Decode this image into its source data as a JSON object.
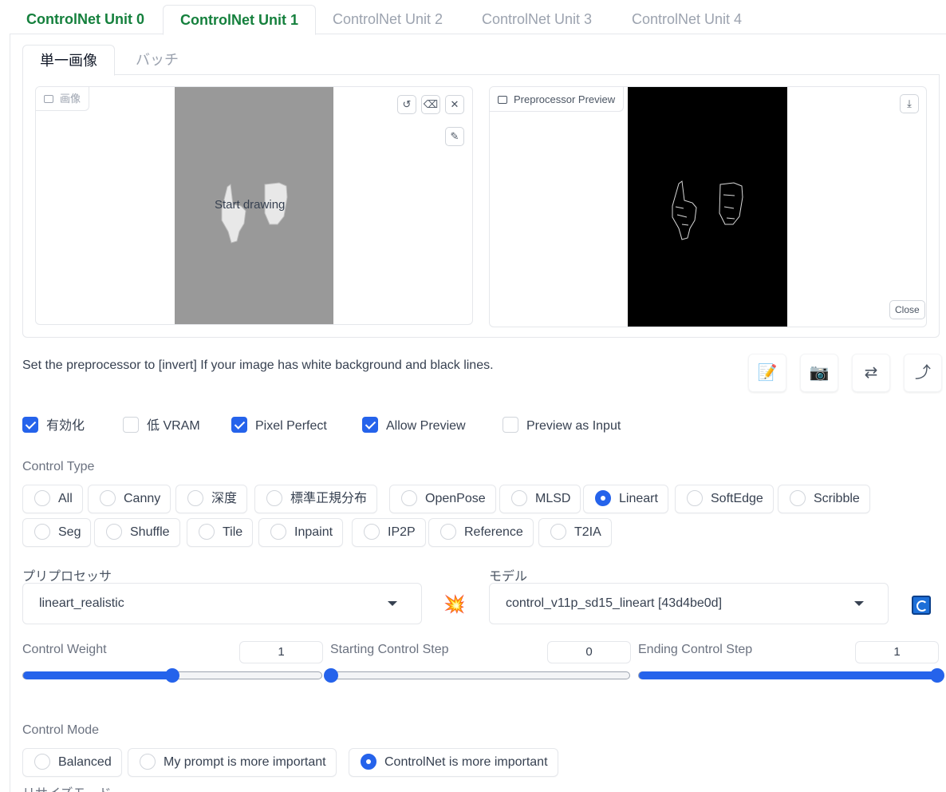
{
  "unit_tabs": [
    {
      "label": "ControlNet Unit 0"
    },
    {
      "label": "ControlNet Unit 1"
    },
    {
      "label": "ControlNet Unit 2"
    },
    {
      "label": "ControlNet Unit 3"
    },
    {
      "label": "ControlNet Unit 4"
    }
  ],
  "image_tabs": [
    {
      "label": "単一画像"
    },
    {
      "label": "バッチ"
    }
  ],
  "input_image": {
    "label": "画像",
    "start_drawing": "Start drawing",
    "canvas_color": "#999999"
  },
  "preview_image": {
    "label": "Preprocessor Preview",
    "close_label": "Close",
    "canvas_color": "#000000"
  },
  "hint_text": "Set the preprocessor to [invert] If your image has white background and black lines.",
  "checkboxes": [
    {
      "label": "有効化",
      "checked": true
    },
    {
      "label": "低 VRAM",
      "checked": false
    },
    {
      "label": "Pixel Perfect",
      "checked": true
    },
    {
      "label": "Allow Preview",
      "checked": true
    },
    {
      "label": "Preview as Input",
      "checked": false
    }
  ],
  "control_type": {
    "label": "Control Type",
    "options": [
      "All",
      "Canny",
      "深度",
      "標準正規分布",
      "OpenPose",
      "MLSD",
      "Lineart",
      "SoftEdge",
      "Scribble",
      "Seg",
      "Shuffle",
      "Tile",
      "Inpaint",
      "IP2P",
      "Reference",
      "T2IA"
    ],
    "selected": "Lineart"
  },
  "preprocessor": {
    "label": "プリプロセッサ",
    "value": "lineart_realistic",
    "run_icon": "💥"
  },
  "model": {
    "label": "モデル",
    "value": "control_v11p_sd15_lineart [43d4be0d]"
  },
  "sliders": [
    {
      "label": "Control Weight",
      "value": "1",
      "fraction": 0.5
    },
    {
      "label": "Starting Control Step",
      "value": "0",
      "fraction": 0.0
    },
    {
      "label": "Ending Control Step",
      "value": "1",
      "fraction": 1.0
    }
  ],
  "control_mode": {
    "label": "Control Mode",
    "options": [
      "Balanced",
      "My prompt is more important",
      "ControlNet is more important"
    ],
    "selected": "ControlNet is more important"
  },
  "resize_mode_label": "リサイズモード",
  "colors": {
    "accent": "#2563eb",
    "active_tab": "#15803d"
  }
}
